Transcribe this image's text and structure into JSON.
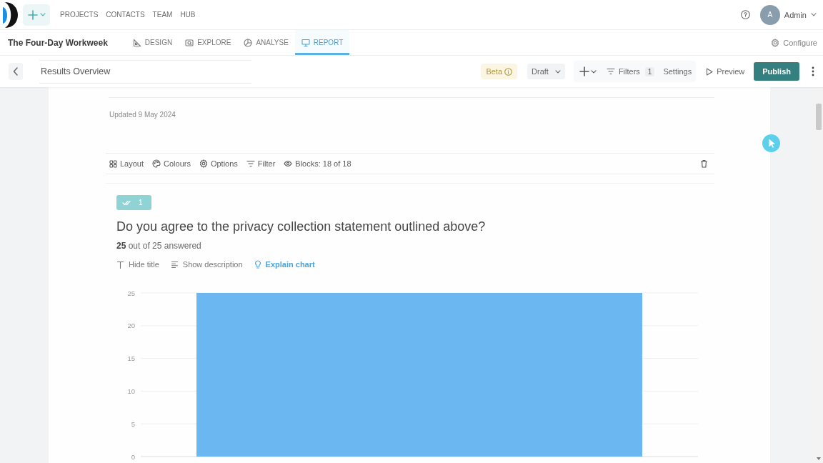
{
  "top_nav": {
    "links": [
      {
        "label": "PROJECTS"
      },
      {
        "label": "CONTACTS"
      },
      {
        "label": "TEAM"
      },
      {
        "label": "HUB"
      }
    ],
    "user": {
      "initial": "A",
      "name": "Admin"
    }
  },
  "project_bar": {
    "title": "The Four-Day Workweek",
    "tabs": [
      {
        "label": "DESIGN",
        "selected": false
      },
      {
        "label": "EXPLORE",
        "selected": false
      },
      {
        "label": "ANALYSE",
        "selected": false
      },
      {
        "label": "REPORT",
        "selected": true
      }
    ],
    "configure": "Configure"
  },
  "report_toolbar": {
    "title": "Results Overview",
    "beta": "Beta",
    "status": "Draft",
    "filters": {
      "label": "Filters",
      "count": "1"
    },
    "settings": "Settings",
    "preview": "Preview",
    "publish": "Publish"
  },
  "report": {
    "updated": "Updated 9 May 2024",
    "block_toolbar": [
      {
        "label": "Layout"
      },
      {
        "label": "Colours"
      },
      {
        "label": "Options"
      },
      {
        "label": "Filter"
      },
      {
        "label": "Blocks: 18 of 18"
      }
    ],
    "question": {
      "number": "1",
      "title": "Do you agree to the privacy collection statement outlined above?",
      "answered": "**25** out of 25 answered",
      "actions": [
        {
          "label": "Hide title",
          "highlighted": false
        },
        {
          "label": "Show description",
          "highlighted": false
        },
        {
          "label": "Explain chart",
          "highlighted": true
        }
      ],
      "chart_data": {
        "type": "bar",
        "categories": [
          null
        ],
        "values": [
          25
        ],
        "color": "#6ab7f2",
        "yticks": [
          0,
          5,
          10,
          15,
          20,
          25
        ],
        "ylim": [
          0,
          25
        ],
        "grid": true
      }
    }
  }
}
